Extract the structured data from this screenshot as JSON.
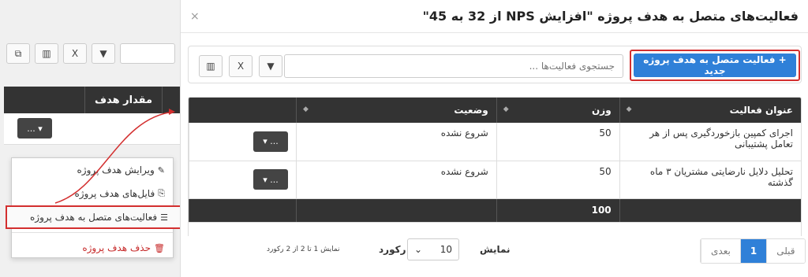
{
  "background": {
    "column_header": "مقدار هدف",
    "dropdown_label": "...",
    "menu": {
      "items": [
        {
          "label": "ویرایش هدف پروژه",
          "icon": "edit-icon"
        },
        {
          "label": "فایل‌های هدف پروژه",
          "icon": "paperclip-icon"
        },
        {
          "label": "فعالیت‌های متصل به هدف پروژه",
          "icon": "list-icon"
        },
        {
          "label": "حذف هدف پروژه",
          "icon": "trash-icon"
        }
      ]
    }
  },
  "modal": {
    "title": "فعالیت‌های متصل به هدف پروژه \"افزایش NPS از 32 به 45\"",
    "close": "×",
    "new_button": "+ فعالیت متصل به هدف پروژه جدید",
    "search_placeholder": "جستجوی فعالیت‌ها ...",
    "columns": {
      "title": "عنوان فعالیت",
      "weight": "وزن",
      "status": "وضعیت"
    },
    "rows": [
      {
        "title": "اجرای کمپین بازخوردگیری پس از هر تعامل پشتیبانی",
        "weight": "50",
        "status": "شروع نشده",
        "action": "..."
      },
      {
        "title": "تحلیل دلایل نارضایتی مشتریان ۳ ماه گذشته",
        "weight": "50",
        "status": "شروع نشده",
        "action": "..."
      }
    ],
    "total": "100",
    "pagination": {
      "prev": "قبلی",
      "current": "1",
      "next": "بعدی"
    },
    "show_label": "نمایش",
    "page_size": "10",
    "records_label": "رکورد",
    "info": "نمایش 1 تا 2 از 2 رکورد"
  },
  "colors": {
    "primary": "#2f80d8",
    "highlight": "#d32f2f",
    "header": "#333333"
  }
}
